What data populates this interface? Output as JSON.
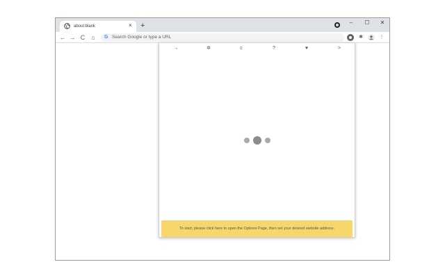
{
  "browser": {
    "tab": {
      "title": "about:blank",
      "close_glyph": "×",
      "favicon": "globe-icon"
    },
    "new_tab_glyph": "+",
    "window_controls": {
      "minimize": "–",
      "maximize": "☐",
      "close": "✕"
    },
    "nav": {
      "back": "←",
      "forward": "→",
      "reload": "C",
      "home": "⌂"
    },
    "omnibox": {
      "google_glyph": "G",
      "placeholder": "Search Google or type a URL"
    },
    "extensions": {
      "puzzle": "✱",
      "menu": "⋮"
    }
  },
  "popup": {
    "toolbar": [
      {
        "icon": "arrow-right-icon",
        "glyph": "→"
      },
      {
        "icon": "gear-icon",
        "glyph": "✲"
      },
      {
        "icon": "refresh-icon",
        "glyph": "c"
      },
      {
        "icon": "help-icon",
        "glyph": "?"
      },
      {
        "icon": "heart-icon",
        "glyph": "♥"
      },
      {
        "icon": "chevron-right-icon",
        "glyph": ">"
      }
    ],
    "banner": {
      "text": "To start, please click here to open the Options Page, then set your desired website address.",
      "color": "#f7d76b"
    }
  }
}
